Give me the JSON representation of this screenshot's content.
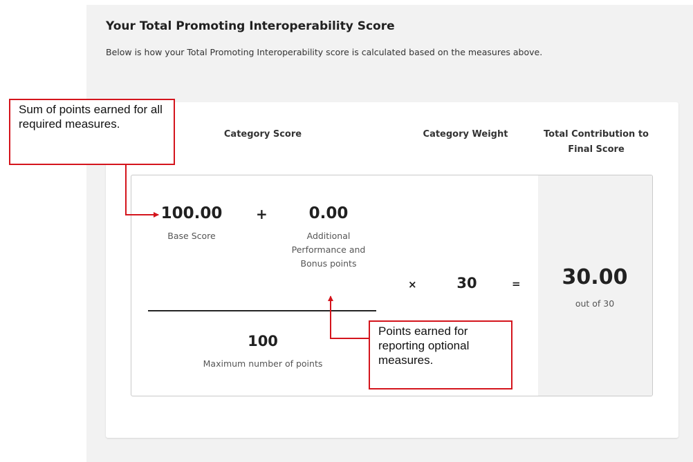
{
  "section": {
    "title": "Your Total Promoting Interoperability Score",
    "description": "Below is how your Total Promoting Interoperability score is calculated based on the measures above."
  },
  "table": {
    "col_category_score": "Category Score",
    "col_category_weight": "Category Weight",
    "col_total_contribution": "Total Contribution to Final Score"
  },
  "calculation": {
    "base_score": "100.00",
    "base_score_label": "Base Score",
    "plus_sign": "+",
    "additional_points": "0.00",
    "additional_points_label": "Additional Performance and Bonus points",
    "max_points": "100",
    "max_points_label": "Maximum number of points",
    "times_sign": "×",
    "weight": "30",
    "equals_sign": "=",
    "total": "30.00",
    "total_label": "out of 30"
  },
  "annotations": {
    "base_note": "Sum of points earned for all required measures.",
    "optional_note": "Points earned for reporting optional measures."
  },
  "colors": {
    "annotation_red": "#d4141c",
    "panel_gray": "#f2f2f2",
    "card_white": "#ffffff"
  }
}
